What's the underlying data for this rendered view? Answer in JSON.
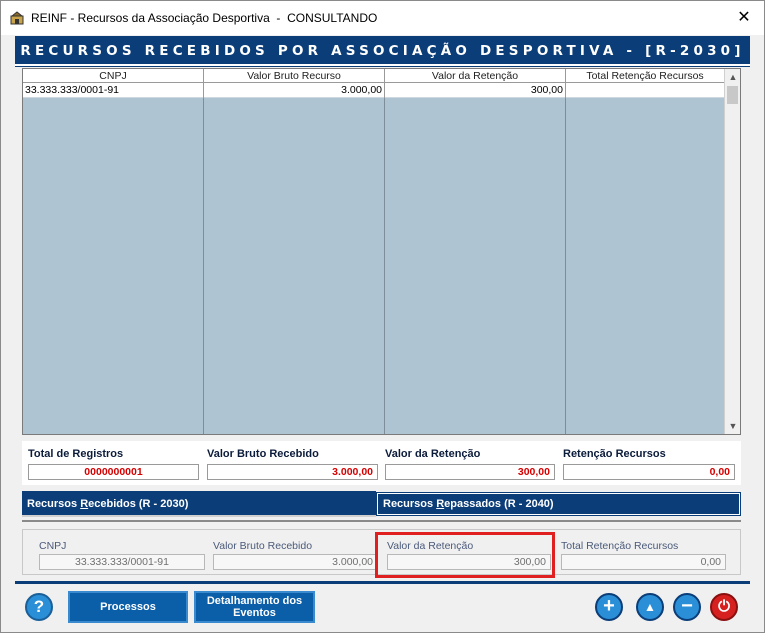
{
  "window": {
    "title": "REINF - Recursos da Associação Desportiva  -  CONSULTANDO",
    "close_glyph": "✕"
  },
  "header": {
    "title": "RECURSOS RECEBIDOS POR ASSOCIAÇÃO DESPORTIVA - [R-2030]"
  },
  "grid": {
    "columns": [
      "CNPJ",
      "Valor Bruto Recurso",
      "Valor da Retenção",
      "Total Retenção Recursos"
    ],
    "rows": [
      {
        "cnpj": "33.333.333/0001-91",
        "valor_bruto": "3.000,00",
        "valor_retencao": "300,00",
        "total_retencao": ""
      }
    ]
  },
  "totals": {
    "total_registros_label": "Total de Registros",
    "total_registros_value": "0000000001",
    "valor_bruto_label": "Valor Bruto Recebido",
    "valor_bruto_value": "3.000,00",
    "valor_retencao_label": "Valor da Retenção",
    "valor_retencao_value": "300,00",
    "retencao_recursos_label": "Retenção Recursos",
    "retencao_recursos_value": "0,00"
  },
  "tabs": {
    "recebidos_pre": "Recursos ",
    "recebidos_u": "R",
    "recebidos_post": "ecebidos (R - 2030)",
    "repassados_pre": "Recursos ",
    "repassados_u": "R",
    "repassados_post": "epassados (R - 2040)"
  },
  "detail": {
    "cnpj_label": "CNPJ",
    "cnpj_value": "33.333.333/0001-91",
    "valor_bruto_label": "Valor Bruto Recebido",
    "valor_bruto_value": "3.000,00",
    "valor_retencao_label": "Valor da Retenção",
    "valor_retencao_value": "300,00",
    "total_retencao_label": "Total Retenção Recursos",
    "total_retencao_value": "0,00"
  },
  "footer": {
    "help_glyph": "?",
    "processos_label": "Processos",
    "detalhamento_line1": "Detalhamento dos",
    "detalhamento_line2": "Eventos",
    "add_glyph": "+",
    "up_glyph": "▲",
    "remove_glyph": "−",
    "power_glyph": "⏻"
  },
  "colors": {
    "accent": "#0b3d78",
    "grid_bg": "#aec4d2",
    "total_value": "#d40000",
    "highlight": "#e02020",
    "btn_blue": "#2a8fd6",
    "btn_power": "#d62020"
  }
}
